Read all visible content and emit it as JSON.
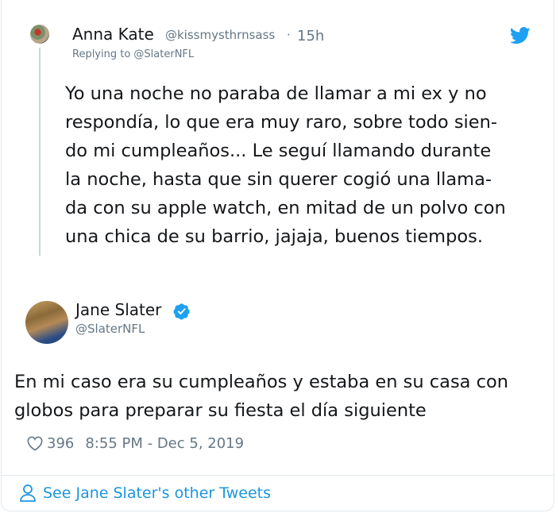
{
  "reply": {
    "name": "Anna Kate",
    "handle": "@kissmysthrnsass",
    "separator": "·",
    "time": "15h",
    "replying_to": "Replying to @SlaterNFL",
    "text": "Yo una noche no paraba de llamar a mi ex y no\nrespondía, lo que era muy raro, sobre todo sien-\ndo mi cumpleaños... Le seguí llamando durante\nla noche, hasta que sin querer cogió una llama-\nda con su apple watch, en mitad de un polvo con\nuna chica de su barrio, jajaja, buenos tiempos."
  },
  "tweet": {
    "name": "Jane Slater",
    "handle": "@SlaterNFL",
    "text": "En mi caso era su cumpleaños y estaba en su casa con\nglobos para preparar su fiesta el día siguiente",
    "likes": "396",
    "timestamp": "8:55 PM - Dec 5, 2019"
  },
  "footer": {
    "see_more": "See Jane Slater's other Tweets"
  },
  "icons": {
    "brand": "twitter-bird-icon",
    "verified": "verified-badge-icon",
    "like": "heart-icon",
    "profile": "person-icon"
  },
  "colors": {
    "brand": "#1da1f2",
    "link": "#1b95e0",
    "muted": "#657786",
    "text": "#14171a"
  }
}
